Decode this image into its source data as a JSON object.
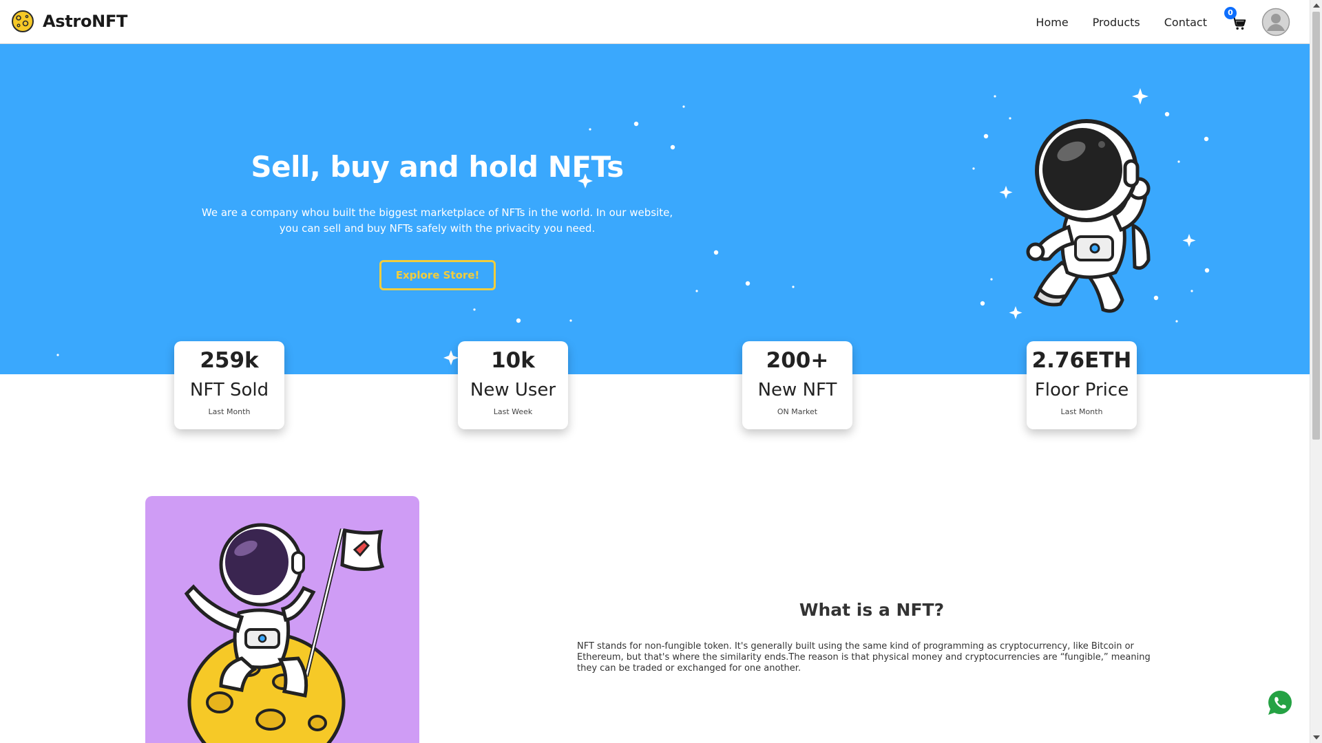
{
  "navbar": {
    "brand_name": "AstroNFT",
    "links": [
      "Home",
      "Products",
      "Contact"
    ],
    "cart_count": "0"
  },
  "hero": {
    "title": "Sell, buy and hold NFTs",
    "description": "We are a company whou built the biggest marketplace of NFTs in the world. In our website, you can sell and buy NFTs safely with the privacity you need.",
    "cta_label": "Explore Store!"
  },
  "stats": [
    {
      "value": "259k",
      "label": "NFT Sold",
      "sub": "Last Month"
    },
    {
      "value": "10k",
      "label": "New User",
      "sub": "Last Week"
    },
    {
      "value": "200+",
      "label": "New NFT",
      "sub": "ON Market"
    },
    {
      "value": "2.76ETH",
      "label": "Floor Price",
      "sub": "Last Month"
    }
  ],
  "nft_section": {
    "title": "What is a NFT?",
    "text": "NFT stands for non-fungible token. It's generally built using the same kind of programming as cryptocurrency, like Bitcoin or Ethereum, but that's where the similarity ends.The reason is that physical money and cryptocurrencies are “fungible,” meaning they can be traded or exchanged for one another."
  },
  "icons": {
    "logo": "moon-logo-icon",
    "cart": "cart-icon",
    "avatar": "user-avatar-icon",
    "whatsapp": "whatsapp-icon"
  },
  "colors": {
    "hero_bg": "#3aa8fd",
    "accent": "#f2cd3c",
    "nft_card_bg": "#cf9cf5",
    "badge": "#0d6efd",
    "whatsapp": "#25a244"
  }
}
